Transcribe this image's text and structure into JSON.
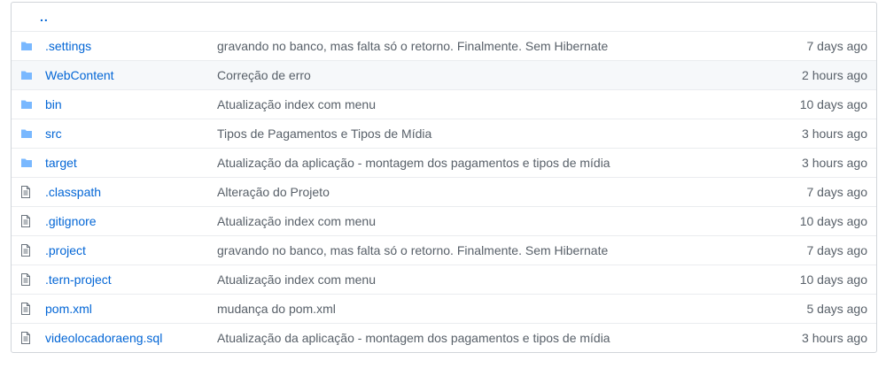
{
  "parent_link": "..",
  "colors": {
    "folder": "#79b8ff",
    "file": "#6a737d",
    "link": "#0366d6",
    "muted": "#586069"
  },
  "entries": [
    {
      "type": "folder",
      "icon": "folder-icon",
      "name": ".settings",
      "message": "gravando no banco, mas falta só o retorno. Finalmente. Sem Hibernate",
      "age": "7 days ago"
    },
    {
      "type": "folder",
      "icon": "folder-icon",
      "name": "WebContent",
      "message": "Correção de erro",
      "age": "2 hours ago"
    },
    {
      "type": "folder",
      "icon": "folder-icon",
      "name": "bin",
      "message": "Atualização index com menu",
      "age": "10 days ago"
    },
    {
      "type": "folder",
      "icon": "folder-icon",
      "name": "src",
      "message": "Tipos de Pagamentos e Tipos de Mídia",
      "age": "3 hours ago"
    },
    {
      "type": "folder",
      "icon": "folder-icon",
      "name": "target",
      "message": "Atualização da aplicação - montagem dos pagamentos e tipos de mídia",
      "age": "3 hours ago"
    },
    {
      "type": "file",
      "icon": "file-icon",
      "name": ".classpath",
      "message": "Alteração do Projeto",
      "age": "7 days ago"
    },
    {
      "type": "file",
      "icon": "file-icon",
      "name": ".gitignore",
      "message": "Atualização index com menu",
      "age": "10 days ago"
    },
    {
      "type": "file",
      "icon": "file-icon",
      "name": ".project",
      "message": "gravando no banco, mas falta só o retorno. Finalmente. Sem Hibernate",
      "age": "7 days ago"
    },
    {
      "type": "file",
      "icon": "file-icon",
      "name": ".tern-project",
      "message": "Atualização index com menu",
      "age": "10 days ago"
    },
    {
      "type": "file",
      "icon": "file-icon",
      "name": "pom.xml",
      "message": "mudança do pom.xml",
      "age": "5 days ago"
    },
    {
      "type": "file",
      "icon": "file-icon",
      "name": "videolocadoraeng.sql",
      "message": "Atualização da aplicação - montagem dos pagamentos e tipos de mídia",
      "age": "3 hours ago"
    }
  ]
}
